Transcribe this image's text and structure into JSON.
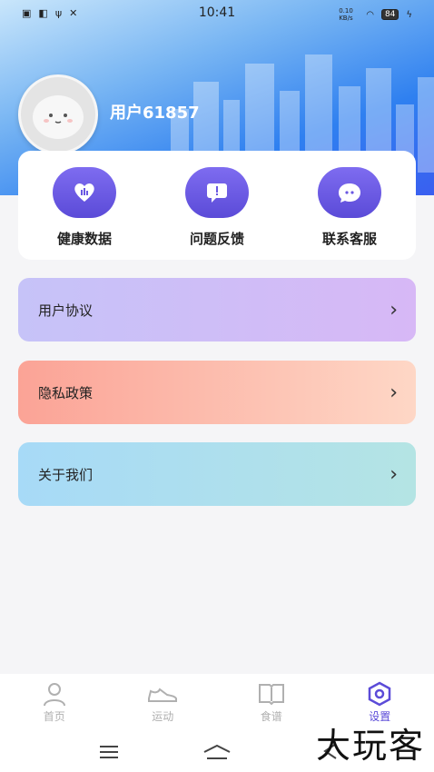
{
  "status_bar": {
    "time": "10:41",
    "net_speed": "0.10 KB/s",
    "battery": "84"
  },
  "profile": {
    "username": "用户61857"
  },
  "quick_actions": [
    {
      "label": "健康数据",
      "icon": "heart-chart-icon"
    },
    {
      "label": "问题反馈",
      "icon": "feedback-icon"
    },
    {
      "label": "联系客服",
      "icon": "chat-bubble-icon"
    }
  ],
  "menu": [
    {
      "label": "用户协议"
    },
    {
      "label": "隐私政策"
    },
    {
      "label": "关于我们"
    }
  ],
  "bottom_nav": [
    {
      "label": "首页",
      "icon": "person-icon",
      "active": false
    },
    {
      "label": "运动",
      "icon": "shoe-icon",
      "active": false
    },
    {
      "label": "食谱",
      "icon": "book-icon",
      "active": false
    },
    {
      "label": "设置",
      "icon": "settings-icon",
      "active": true
    }
  ],
  "watermark": "大玩客",
  "colors": {
    "accent": "#5b4bd8",
    "header_blue": "#2f80f0"
  }
}
